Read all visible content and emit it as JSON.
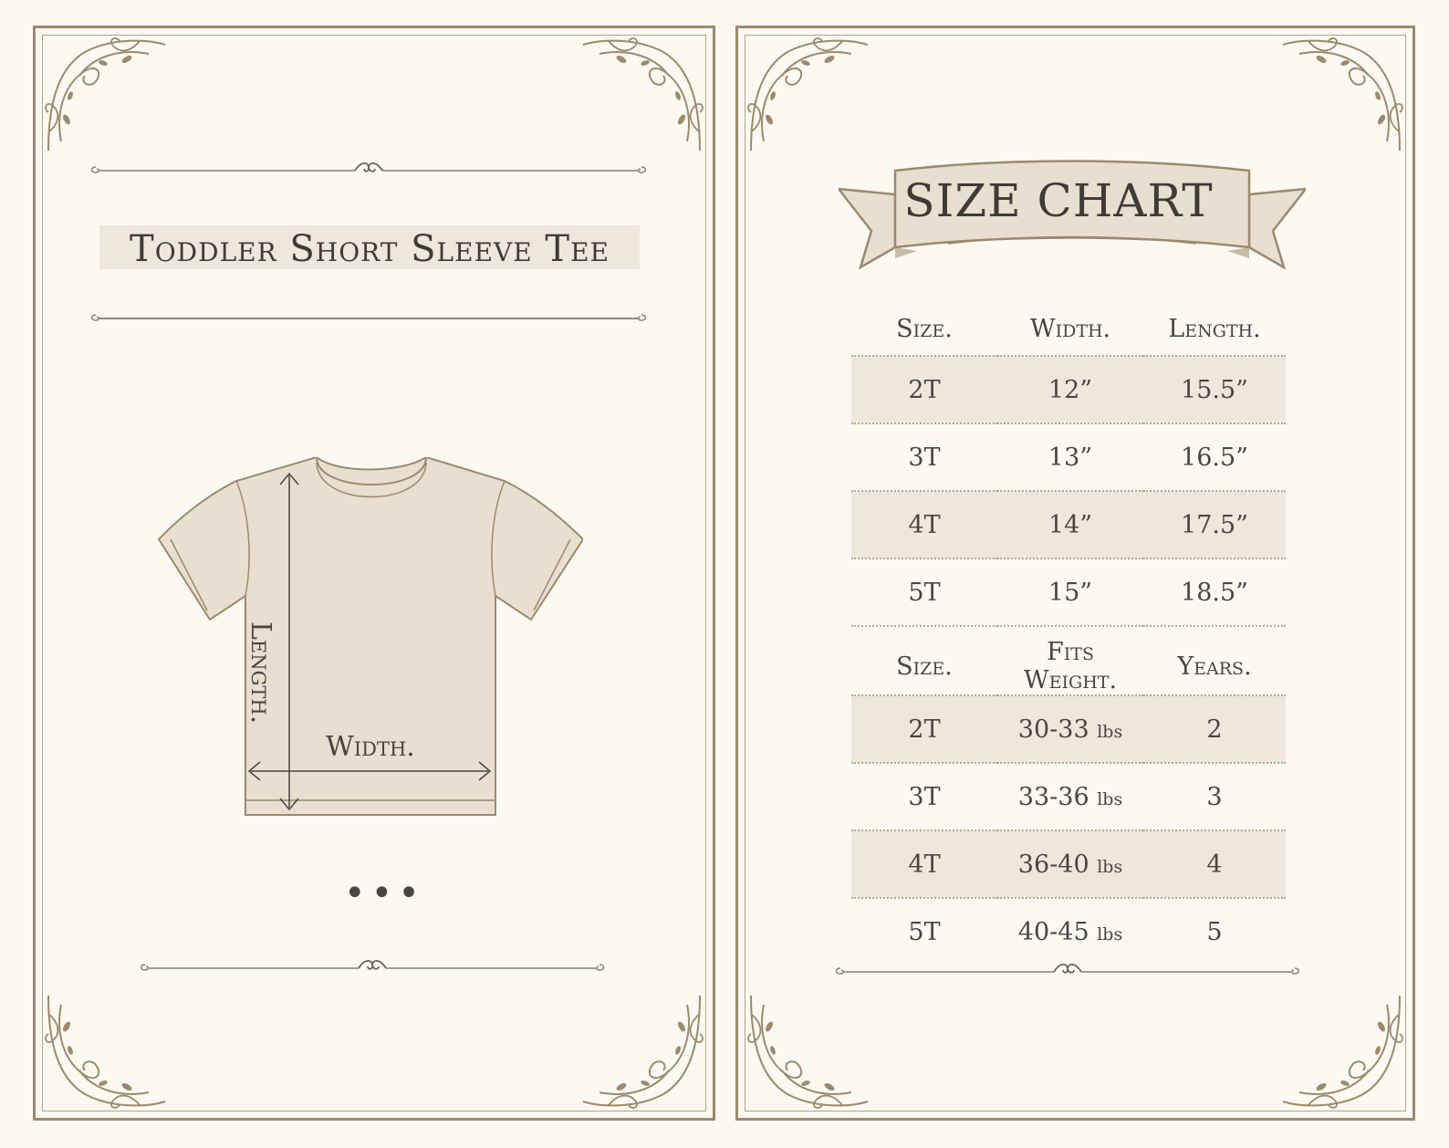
{
  "left_panel": {
    "title": "Toddler Short Sleeve Tee",
    "label_length": "Length.",
    "label_width": "Width.",
    "ellipsis": "•••"
  },
  "right_panel": {
    "heading": "SIZE CHART",
    "measure_table": {
      "headers": [
        "Size.",
        "Width.",
        "Length."
      ],
      "rows": [
        [
          "2T",
          "12”",
          "15.5”"
        ],
        [
          "3T",
          "13”",
          "16.5”"
        ],
        [
          "4T",
          "14”",
          "17.5”"
        ],
        [
          "5T",
          "15”",
          "18.5”"
        ]
      ]
    },
    "fit_table": {
      "headers": [
        "Size.",
        "Fits Weight.",
        "Years."
      ],
      "rows": [
        [
          "2T",
          "30-33",
          "lbs",
          "2"
        ],
        [
          "3T",
          "33-36",
          "lbs",
          "3"
        ],
        [
          "4T",
          "36-40",
          "lbs",
          "4"
        ],
        [
          "5T",
          "40-45",
          "lbs",
          "5"
        ]
      ]
    }
  },
  "colors": {
    "background": "#fbf9f2",
    "frame": "#9b8a6e",
    "shade": "#efe7dc",
    "shirt": "#e8dfd0",
    "text": "#4a4540"
  }
}
